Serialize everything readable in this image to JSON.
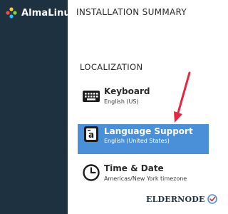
{
  "sidebar": {
    "brand_name": "AlmaLinux"
  },
  "header": {
    "title": "INSTALLATION SUMMARY"
  },
  "localization": {
    "section_title": "LOCALIZATION",
    "spokes": [
      {
        "title": "Keyboard",
        "status": "English (US)",
        "icon": "keyboard-icon"
      },
      {
        "title": "Language Support",
        "status": "English (United States)",
        "icon": "language-icon",
        "selected": true
      },
      {
        "title": "Time & Date",
        "status": "Americas/New York timezone",
        "icon": "clock-icon"
      }
    ]
  },
  "colors": {
    "sidebar": "#1d3141",
    "selected": "#4a90d9",
    "annotation_arrow": "#e8263f"
  },
  "watermark": {
    "text": "ELDERNODE",
    "icon": "eldernode-logo-icon"
  }
}
